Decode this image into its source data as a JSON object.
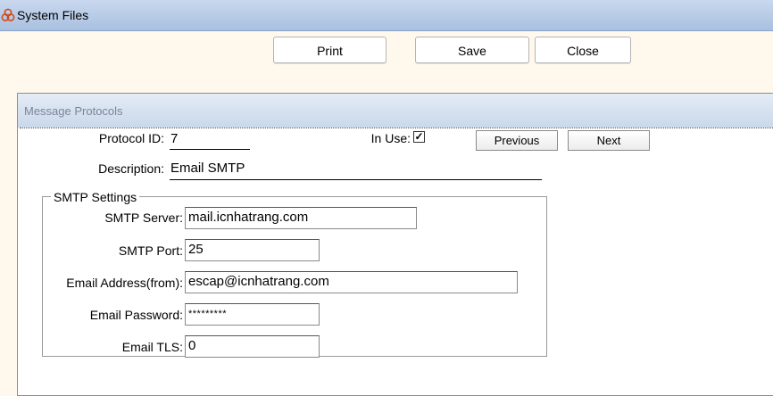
{
  "window": {
    "title": "System Files",
    "icon": "recycle-icon"
  },
  "toolbar": {
    "print_label": "Print",
    "save_label": "Save",
    "close_label": "Close"
  },
  "panel": {
    "title": "Message Protocols"
  },
  "protocol": {
    "id_label": "Protocol ID:",
    "id_value": "7",
    "in_use_label": "In Use:",
    "in_use_checked": true,
    "in_use_mark": "✓",
    "description_label": "Description:",
    "description_value": "Email SMTP",
    "previous_label": "Previous",
    "next_label": "Next"
  },
  "smtp": {
    "legend": "SMTP Settings",
    "server_label": "SMTP Server:",
    "server_value": "mail.icnhatrang.com",
    "port_label": "SMTP Port:",
    "port_value": "25",
    "email_label": "Email Address(from):",
    "email_value": "escap@icnhatrang.com",
    "password_label": "Email Password:",
    "password_value": "*********",
    "tls_label": "Email TLS:",
    "tls_value": "0"
  }
}
